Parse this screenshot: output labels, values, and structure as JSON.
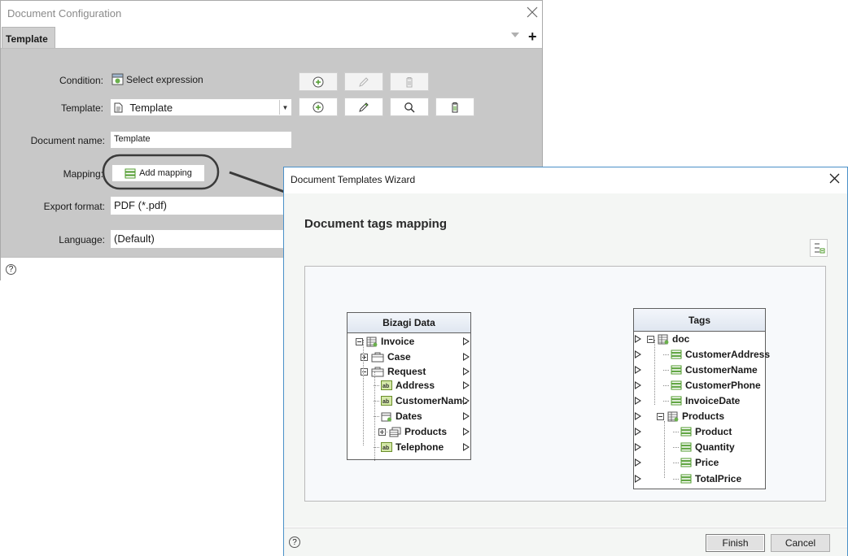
{
  "config_window": {
    "title": "Document Configuration",
    "tab": "Template",
    "tab_add": "+",
    "condition": {
      "label": "Condition:",
      "value": "Select expression"
    },
    "template": {
      "label": "Template:",
      "value": "Template"
    },
    "document_name": {
      "label": "Document name:",
      "value": "Template"
    },
    "mapping": {
      "label": "Mapping:",
      "button": "Add mapping"
    },
    "export_format": {
      "label": "Export format:",
      "value": "PDF (*.pdf)"
    },
    "language": {
      "label": "Language:",
      "value": "(Default)"
    },
    "help": "?"
  },
  "wizard": {
    "title": "Document Templates Wizard",
    "heading": "Document tags mapping",
    "help": "?",
    "finish": "Finish",
    "cancel": "Cancel",
    "bizagi_panel": {
      "title": "Bizagi Data",
      "nodes": [
        {
          "label": "Invoice",
          "icon": "table-icon",
          "expander": "minus"
        },
        {
          "label": "Case",
          "icon": "case-icon",
          "expander": "plus"
        },
        {
          "label": "Request",
          "icon": "case-icon",
          "expander": "minus"
        },
        {
          "label": "Address",
          "icon": "text-field-icon"
        },
        {
          "label": "CustomerName",
          "icon": "text-field-icon"
        },
        {
          "label": "Dates",
          "icon": "date-icon"
        },
        {
          "label": "Products",
          "icon": "collection-icon",
          "expander": "plus"
        },
        {
          "label": "Telephone",
          "icon": "text-field-icon"
        }
      ]
    },
    "tags_panel": {
      "title": "Tags",
      "nodes": [
        {
          "label": "doc",
          "icon": "table-icon",
          "expander": "minus"
        },
        {
          "label": "CustomerAddress",
          "icon": "tag-icon"
        },
        {
          "label": "CustomerName",
          "icon": "tag-icon"
        },
        {
          "label": "CustomerPhone",
          "icon": "tag-icon"
        },
        {
          "label": "InvoiceDate",
          "icon": "tag-icon"
        },
        {
          "label": "Products",
          "icon": "table-icon",
          "expander": "minus"
        },
        {
          "label": "Product",
          "icon": "tag-icon"
        },
        {
          "label": "Quantity",
          "icon": "tag-icon"
        },
        {
          "label": "Price",
          "icon": "tag-icon"
        },
        {
          "label": "TotalPrice",
          "icon": "tag-icon"
        }
      ]
    }
  },
  "colors": {
    "window_gray": "#c8c8c8",
    "wizard_border": "#4a90c8",
    "icon_green": "#5a9a2a",
    "callout": "#3a3a3a"
  }
}
